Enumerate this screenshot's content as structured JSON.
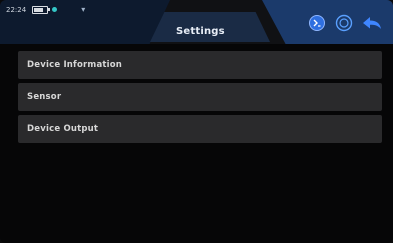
{
  "status_bar": {
    "time": "22:24"
  },
  "header": {
    "title": "Settings",
    "icons": [
      "status-icon",
      "circle-icon",
      "back-icon"
    ]
  },
  "settings_list": {
    "items": [
      {
        "label": "Device Information"
      },
      {
        "label": "Sensor"
      },
      {
        "label": "Device Output"
      }
    ]
  },
  "colors": {
    "background": "#060607",
    "header_accent": "#1b3a6b",
    "list_item_bg": "#2a2a2c",
    "icon_blue": "#3f86ff"
  }
}
